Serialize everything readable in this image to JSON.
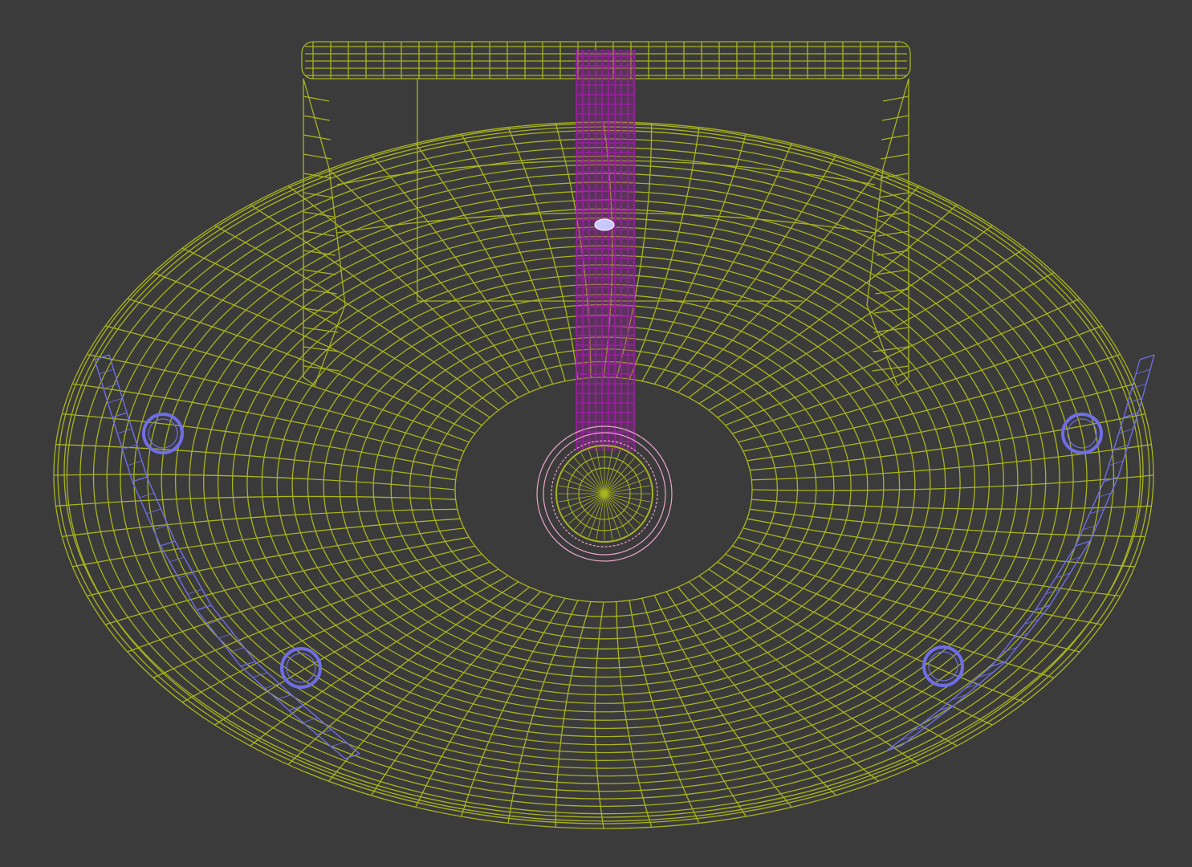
{
  "viewport": {
    "mode": "wireframe",
    "view": "top",
    "background": "#3b3b3b"
  },
  "colors": {
    "basin": "#a8b51e",
    "faucet": "#9a1fa0",
    "drain_ring": "#e9a6c8",
    "towel_rail": "#6f6ee8",
    "faucet_knob": "#c8c8ff"
  },
  "objects": [
    {
      "name": "basin-wireframe",
      "label": ""
    },
    {
      "name": "backsplash-wireframe",
      "label": ""
    },
    {
      "name": "faucet-spout-wireframe",
      "label": ""
    },
    {
      "name": "drain-wireframe",
      "label": ""
    },
    {
      "name": "towel-rail-left-wireframe",
      "label": ""
    },
    {
      "name": "towel-rail-right-wireframe",
      "label": ""
    }
  ]
}
